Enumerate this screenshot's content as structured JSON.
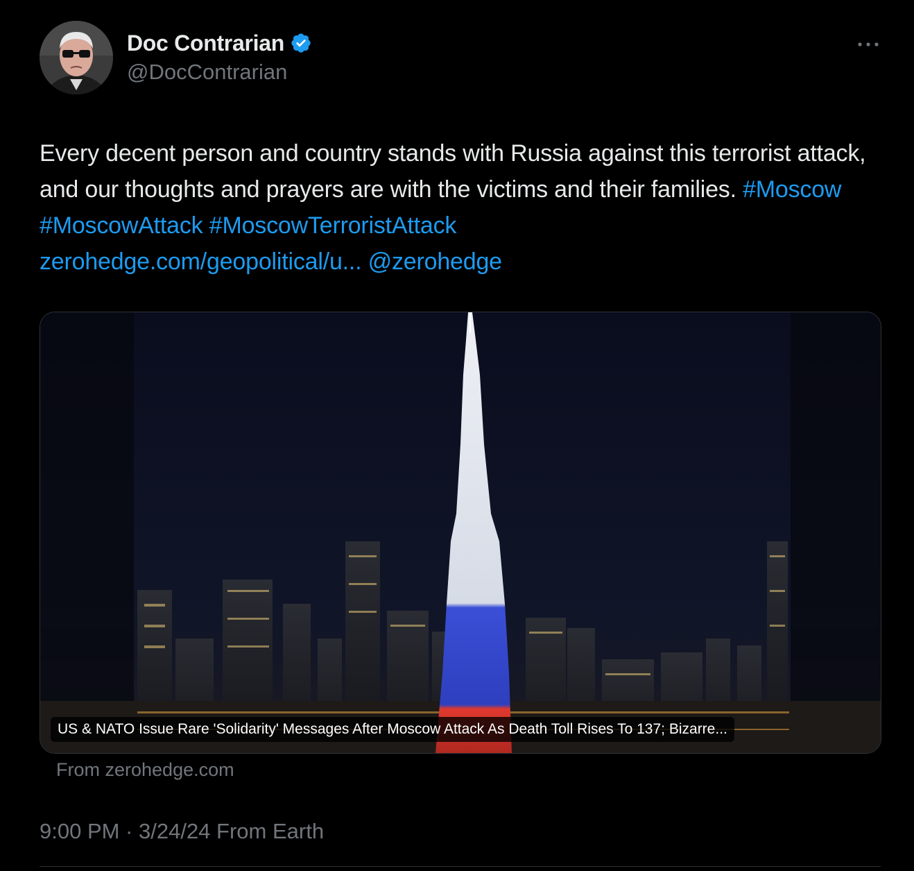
{
  "author": {
    "display_name": "Doc Contrarian",
    "handle": "@DocContrarian",
    "verified": true,
    "verified_color": "#1d9bf0"
  },
  "tweet": {
    "text_plain": "Every decent person and country stands with Russia against this terrorist attack, and our thoughts and prayers are with the victims and their families. ",
    "hashtags": [
      "#Moscow",
      "#MoscowAttack",
      "#MoscowTerroristAttack"
    ],
    "link": "zerohedge.com/geopolitical/u...",
    "mention": "@zerohedge",
    "link_color": "#1d9bf0"
  },
  "card": {
    "title": "US & NATO Issue Rare 'Solidarity' Messages After Moscow Attack As Death Toll Rises To 137; Bizarre...",
    "source": "From zerohedge.com"
  },
  "meta": {
    "timestamp": "9:00 PM · 3/24/24 From Earth"
  },
  "icons": {
    "more": "more-horizontal-icon",
    "verified": "verified-badge-icon"
  }
}
